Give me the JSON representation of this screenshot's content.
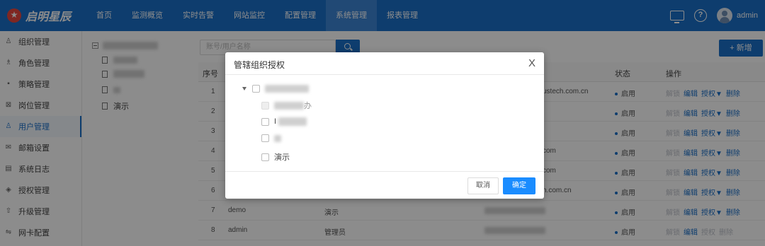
{
  "brand": {
    "name": "启明星辰",
    "accent": "#1a6fc8"
  },
  "nav": {
    "items": [
      {
        "label": "首页"
      },
      {
        "label": "监测概览"
      },
      {
        "label": "实时告警"
      },
      {
        "label": "网站监控"
      },
      {
        "label": "配置管理"
      },
      {
        "label": "系统管理",
        "active": true
      },
      {
        "label": "报表管理"
      }
    ],
    "user": "admin",
    "help_glyph": "?"
  },
  "sidebar": {
    "items": [
      {
        "label": "组织管理",
        "icon": "org-icon",
        "glyph": "♙"
      },
      {
        "label": "角色管理",
        "icon": "role-icon",
        "glyph": "♗"
      },
      {
        "label": "策略管理",
        "icon": "policy-icon",
        "glyph": "▪"
      },
      {
        "label": "岗位管理",
        "icon": "post-icon",
        "glyph": "⊠"
      },
      {
        "label": "用户管理",
        "icon": "user-icon",
        "glyph": "♙",
        "active": true
      },
      {
        "label": "邮箱设置",
        "icon": "mail-icon",
        "glyph": "✉"
      },
      {
        "label": "系统日志",
        "icon": "log-icon",
        "glyph": "▤"
      },
      {
        "label": "授权管理",
        "icon": "license-icon",
        "glyph": "◈"
      },
      {
        "label": "升级管理",
        "icon": "upgrade-icon",
        "glyph": "⇧"
      },
      {
        "label": "网卡配置",
        "icon": "nic-icon",
        "glyph": "⇋"
      }
    ]
  },
  "org_tree": {
    "visible_node": "演示"
  },
  "toolbar": {
    "search_placeholder": "账号/用户名称",
    "add_label": "+ 新增"
  },
  "table": {
    "headers": {
      "index": "序号",
      "status": "状态",
      "actions": "操作"
    },
    "rows": [
      {
        "index": "1",
        "account": "",
        "name": "",
        "email_tail": "ustech.com.cn",
        "status": "启用"
      },
      {
        "index": "2",
        "account": "",
        "name": "",
        "email_tail": "",
        "status": "启用"
      },
      {
        "index": "3",
        "account": "",
        "name": "",
        "email_tail": "",
        "status": "启用"
      },
      {
        "index": "4",
        "account": "",
        "name": "",
        "email_tail": "com",
        "status": "启用"
      },
      {
        "index": "5",
        "account": "",
        "name": "",
        "email_tail": "com",
        "status": "启用"
      },
      {
        "index": "6",
        "account": "",
        "name": "",
        "email_tail": "h.com.cn",
        "status": "启用"
      },
      {
        "index": "7",
        "account": "demo",
        "name": "演示",
        "email_tail": "",
        "status": "启用"
      },
      {
        "index": "8",
        "account": "admin",
        "name": "管理员",
        "email_tail": "",
        "status": "启用"
      }
    ],
    "ops": {
      "unlock": "解锁",
      "edit": "编辑",
      "authorize": "授权▼",
      "delete": "删除",
      "authorize_plain": "授权"
    }
  },
  "modal": {
    "title": "管辖组织授权",
    "close": "X",
    "tree": {
      "row2_tail": "办",
      "row3_lead": "I",
      "leaf": "演示"
    },
    "cancel_label": "取消",
    "ok_label": "确定"
  }
}
